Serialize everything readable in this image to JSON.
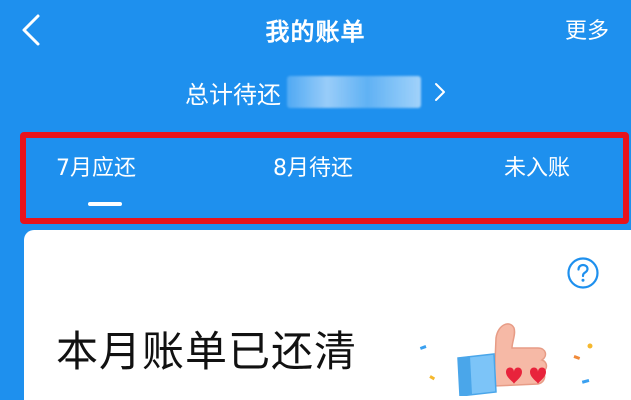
{
  "header": {
    "title": "我的账单",
    "more_label": "更多"
  },
  "summary": {
    "label": "总计待还"
  },
  "tabs": [
    {
      "label": "7月应还",
      "active": true
    },
    {
      "label": "8月待还",
      "active": false
    },
    {
      "label": "未入账",
      "active": false
    }
  ],
  "card": {
    "status_text": "本月账单已还清"
  },
  "colors": {
    "primary": "#1e90ee",
    "highlight_border": "#e8131b",
    "card_bg": "#ffffff",
    "text_dark": "#111111"
  },
  "icons": [
    "back-icon",
    "chevron-right-icon",
    "help-icon",
    "thumbs-up-icon"
  ]
}
